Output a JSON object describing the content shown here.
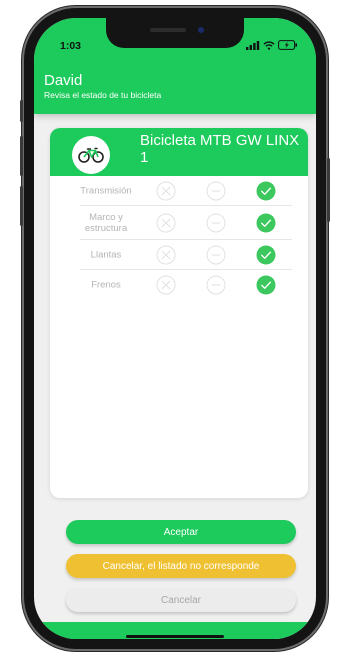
{
  "status_bar": {
    "time": "1:03"
  },
  "header": {
    "user_name": "David",
    "subtitle": "Revisa el estado de tu bicicleta"
  },
  "card": {
    "bike_icon": "bicycle-icon",
    "bike_name": "Bicicleta MTB GW LINX 1",
    "checklist": [
      {
        "label": "Transmisión",
        "selected": "ok"
      },
      {
        "label": "Marco y estructura",
        "selected": "ok"
      },
      {
        "label": "Llantas",
        "selected": "ok"
      },
      {
        "label": "Frenos",
        "selected": "ok"
      }
    ]
  },
  "actions": {
    "accept_label": "Aceptar",
    "mismatch_label": "Cancelar, el listado no corresponde",
    "cancel_label": "Cancelar"
  },
  "colors": {
    "brand_green": "#1ccb5b",
    "ok_green": "#3cc85e",
    "warning_yellow": "#efc132",
    "neutral_gray": "#ececec"
  }
}
